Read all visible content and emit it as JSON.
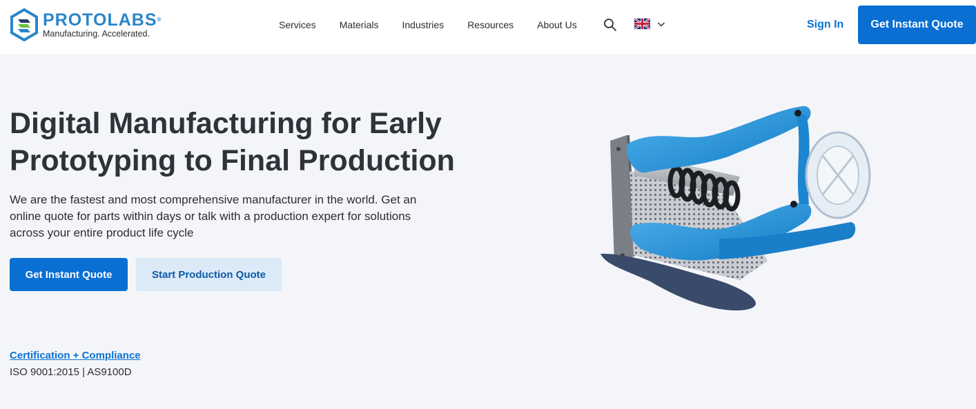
{
  "brand": {
    "name": "PROTOLABS",
    "trademark": "®",
    "tagline": "Manufacturing. Accelerated."
  },
  "nav": {
    "items": [
      "Services",
      "Materials",
      "Industries",
      "Resources",
      "About Us"
    ]
  },
  "header": {
    "sign_in": "Sign In",
    "quote_label": "Get Instant Quote"
  },
  "hero": {
    "title": "Digital Manufacturing for Early Prototyping to Final Production",
    "subtitle": "We are the fastest and most comprehensive manufacturer in the world. Get an online quote for parts within days or talk with a production expert for solutions across your entire product life cycle",
    "primary_cta": "Get Instant Quote",
    "secondary_cta": "Start Production Quote"
  },
  "certification": {
    "link": "Certification + Compliance",
    "text": "ISO 9001:2015 | AS9100D"
  },
  "icons": {
    "search": "search-icon",
    "language": "uk-flag-icon",
    "dropdown": "chevron-down-icon"
  },
  "colors": {
    "brand_blue": "#2a86c8",
    "cta_blue": "#0a6fd3",
    "secondary_bg": "#dceaf8",
    "page_bg": "#f4f5f9"
  }
}
